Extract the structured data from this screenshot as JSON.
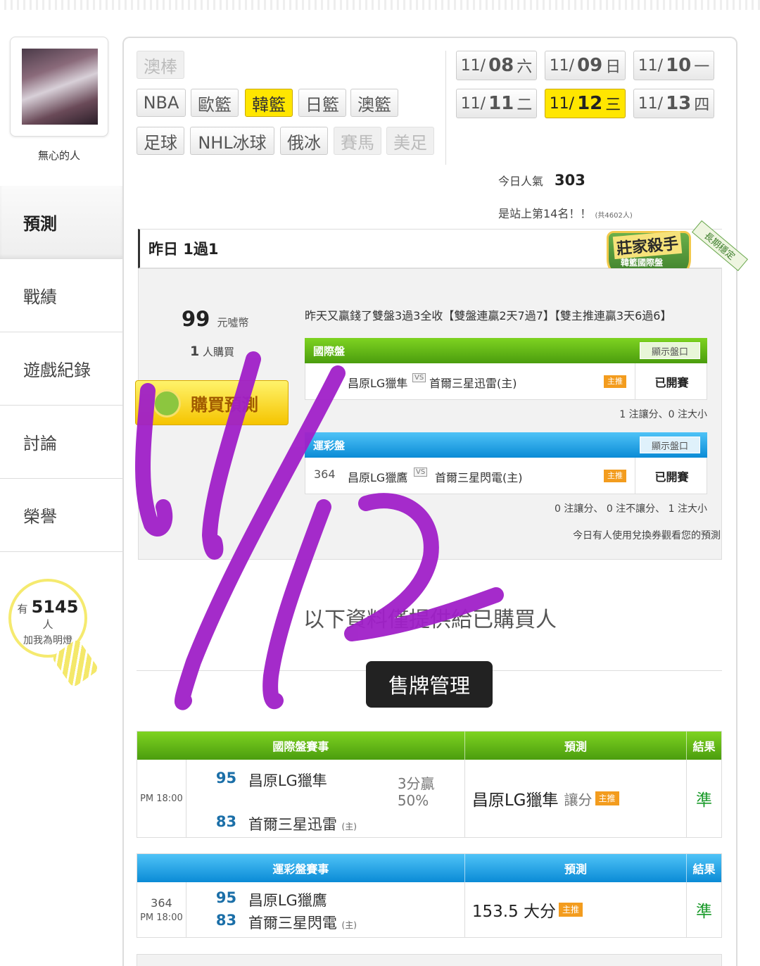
{
  "profile": {
    "name": "無心的人"
  },
  "sidebar": {
    "items": [
      {
        "label": "預測",
        "active": true
      },
      {
        "label": "戰績"
      },
      {
        "label": "遊戲紀錄"
      },
      {
        "label": "討論"
      },
      {
        "label": "榮譽"
      }
    ]
  },
  "fans": {
    "prefix": "有",
    "count": "5145",
    "unit": "人",
    "cta": "加我為明燈"
  },
  "sports": {
    "row1": [
      "澳棒"
    ],
    "row2": [
      "NBA",
      "歐籃",
      "韓籃",
      "日籃",
      "澳籃"
    ],
    "row3": [
      "足球",
      "NHL冰球",
      "俄冰",
      "賽馬",
      "美足"
    ],
    "selected": "韓籃"
  },
  "dates": [
    {
      "m": "11/",
      "d": "08",
      "w": "六"
    },
    {
      "m": "11/",
      "d": "09",
      "w": "日"
    },
    {
      "m": "11/",
      "d": "10",
      "w": "一"
    },
    {
      "m": "11/",
      "d": "11",
      "w": "二"
    },
    {
      "m": "11/",
      "d": "12",
      "w": "三",
      "selected": true
    },
    {
      "m": "11/",
      "d": "13",
      "w": "四"
    }
  ],
  "popularity": {
    "label": "今日人氣",
    "value": "303",
    "rank_text": "是站上第14名！！",
    "total": "(共4602人)"
  },
  "yesterday": {
    "label": "昨日 1過1"
  },
  "badge": {
    "title": "莊家殺手",
    "subtitle": "韓籃國際盤",
    "ribbon": "長期穩定"
  },
  "purchase": {
    "price": "99",
    "price_unit": "元噓幣",
    "buyers_count": "1",
    "buyers_label": "人購買",
    "button": "購買預測"
  },
  "summary": "昨天又贏錢了雙盤3過3全收【雙盤連贏2天7過7】【雙主推連贏3天6過6】",
  "intl": {
    "title": "國際盤",
    "show_btn": "顯示盤口",
    "home": "昌原LG獵隼",
    "vs": "VS",
    "away": "首爾三星迅雷(主)",
    "tag": "主推",
    "status": "已開賽",
    "note": "1 注讓分、0 注大小"
  },
  "lottery": {
    "title": "運彩盤",
    "show_btn": "顯示盤口",
    "id": "364",
    "home": "昌原LG獵鷹",
    "vs": "VS",
    "away": "首爾三星閃電(主)",
    "tag": "主推",
    "status": "已開賽",
    "note": "0 注讓分、 0 注不讓分、 1 注大小"
  },
  "coupon_note": "今日有人使用兌換券觀看您的預測",
  "notice": "以下資料僅提供給已購買人",
  "sell_button": "售牌管理",
  "tables": {
    "intl": {
      "h1": "國際盤賽事",
      "h2": "預測",
      "h3": "結果",
      "time": "PM 18:00",
      "team1_score": "95",
      "team1": "昌原LG獵隼",
      "team2_score": "83",
      "team2": "首爾三星迅雷",
      "team2_suffix": "(主)",
      "odds1": "3分贏",
      "odds2": "50%",
      "pred_team": "昌原LG獵隼",
      "pred_type": "讓分",
      "pred_tag": "主推",
      "result": "準"
    },
    "lottery": {
      "h1": "運彩盤賽事",
      "h2": "預測",
      "h3": "結果",
      "id": "364",
      "time": "PM 18:00",
      "team1_score": "95",
      "team1": "昌原LG獵鷹",
      "team2_score": "83",
      "team2": "首爾三星閃電",
      "team2_suffix": "(主)",
      "pred_text": "153.5 大分",
      "pred_tag": "主推",
      "result": "準"
    }
  },
  "colors": {
    "accent_yellow": "#ffe600",
    "green_bar": "#5cb31a",
    "blue_bar": "#1aa0e4",
    "scribble": "#a020c8"
  }
}
